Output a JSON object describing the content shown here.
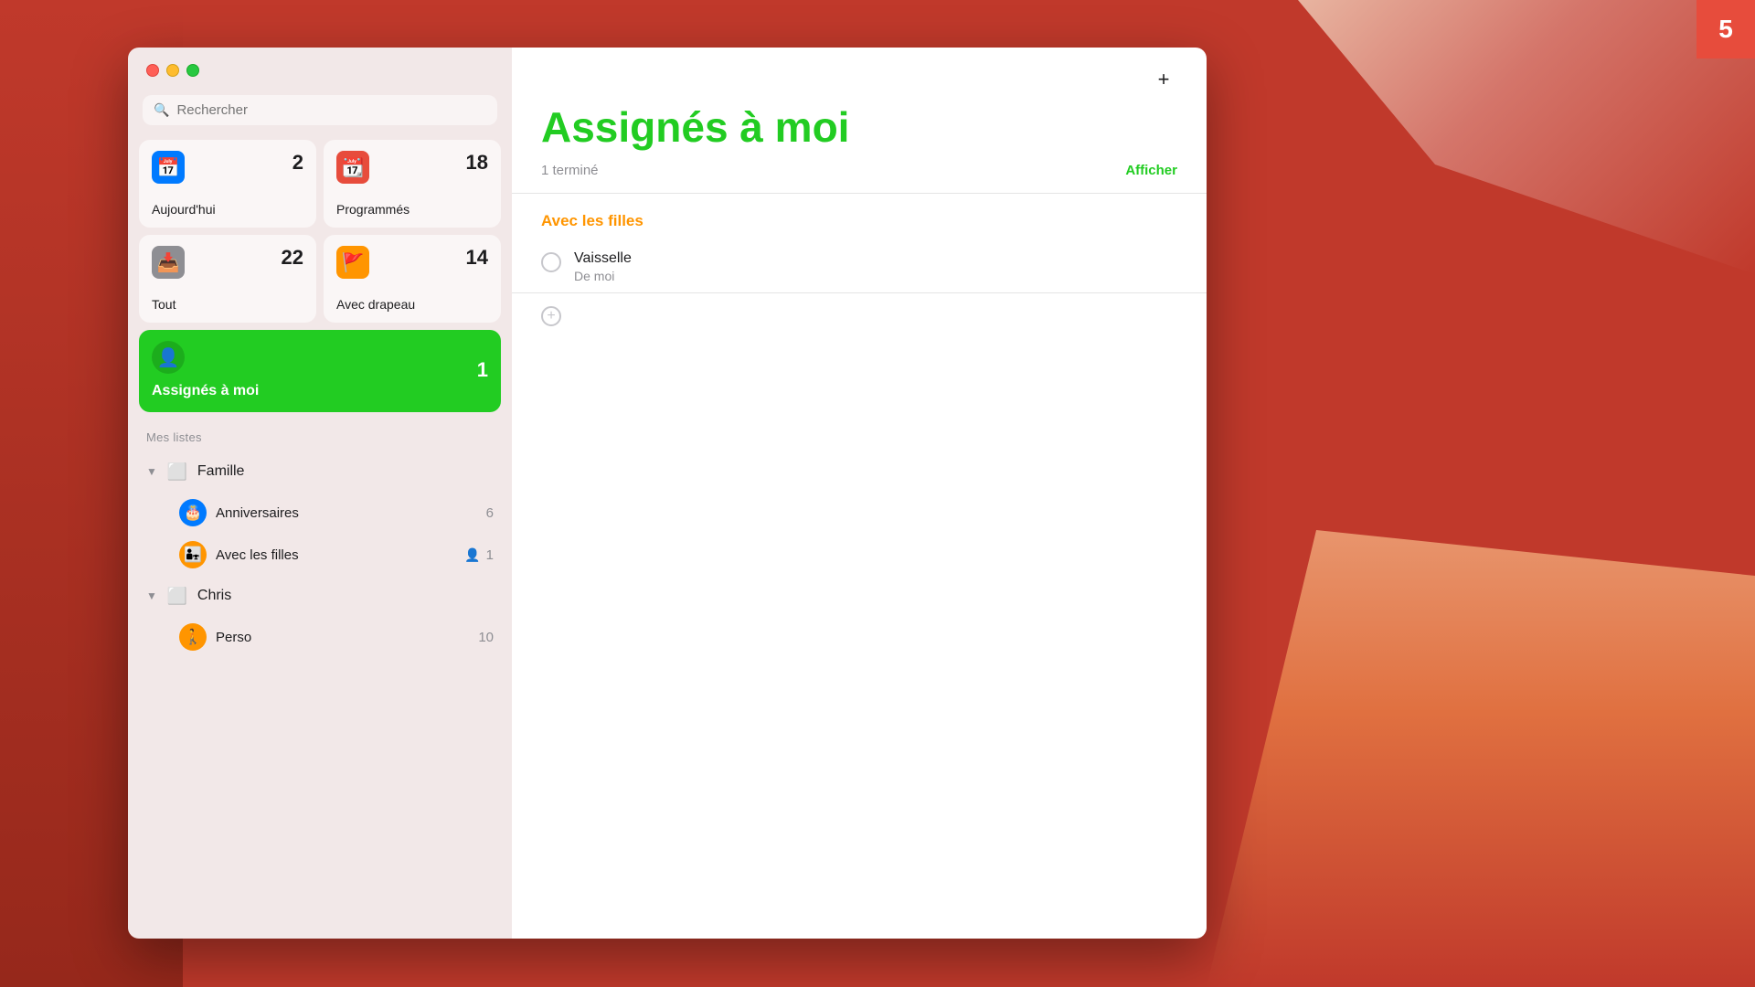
{
  "badge": {
    "count": "5"
  },
  "sidebar": {
    "search_placeholder": "Rechercher",
    "smart_lists": [
      {
        "id": "today",
        "icon": "📅",
        "icon_class": "icon-today",
        "label": "Aujourd'hui",
        "count": "2"
      },
      {
        "id": "scheduled",
        "icon": "📆",
        "icon_class": "icon-scheduled",
        "label": "Programmés",
        "count": "18"
      },
      {
        "id": "all",
        "icon": "📥",
        "icon_class": "icon-all",
        "label": "Tout",
        "count": "22"
      },
      {
        "id": "flagged",
        "icon": "🚩",
        "icon_class": "icon-flagged",
        "label": "Avec drapeau",
        "count": "14"
      }
    ],
    "assigned": {
      "label": "Assignés à moi",
      "count": "1"
    },
    "my_lists_label": "Mes listes",
    "groups": [
      {
        "name": "Famille",
        "lists": [
          {
            "id": "anniversaires",
            "icon": "🎂",
            "icon_class": "icon-birthday",
            "name": "Anniversaires",
            "count": "6",
            "shared": false
          },
          {
            "id": "avec-les-filles",
            "icon": "👨‍👧",
            "icon_class": "icon-family",
            "name": "Avec les filles",
            "count": "1",
            "shared": true
          }
        ]
      },
      {
        "name": "Chris",
        "lists": [
          {
            "id": "perso",
            "icon": "🚶",
            "icon_class": "icon-perso",
            "name": "Perso",
            "count": "10",
            "shared": false
          }
        ]
      }
    ]
  },
  "main": {
    "title": "Assignés à moi",
    "completed_text": "1 terminé",
    "afficher_label": "Afficher",
    "plus_label": "+",
    "group_header": "Avec les filles",
    "tasks": [
      {
        "name": "Vaisselle",
        "subtitle": "De moi"
      }
    ]
  }
}
